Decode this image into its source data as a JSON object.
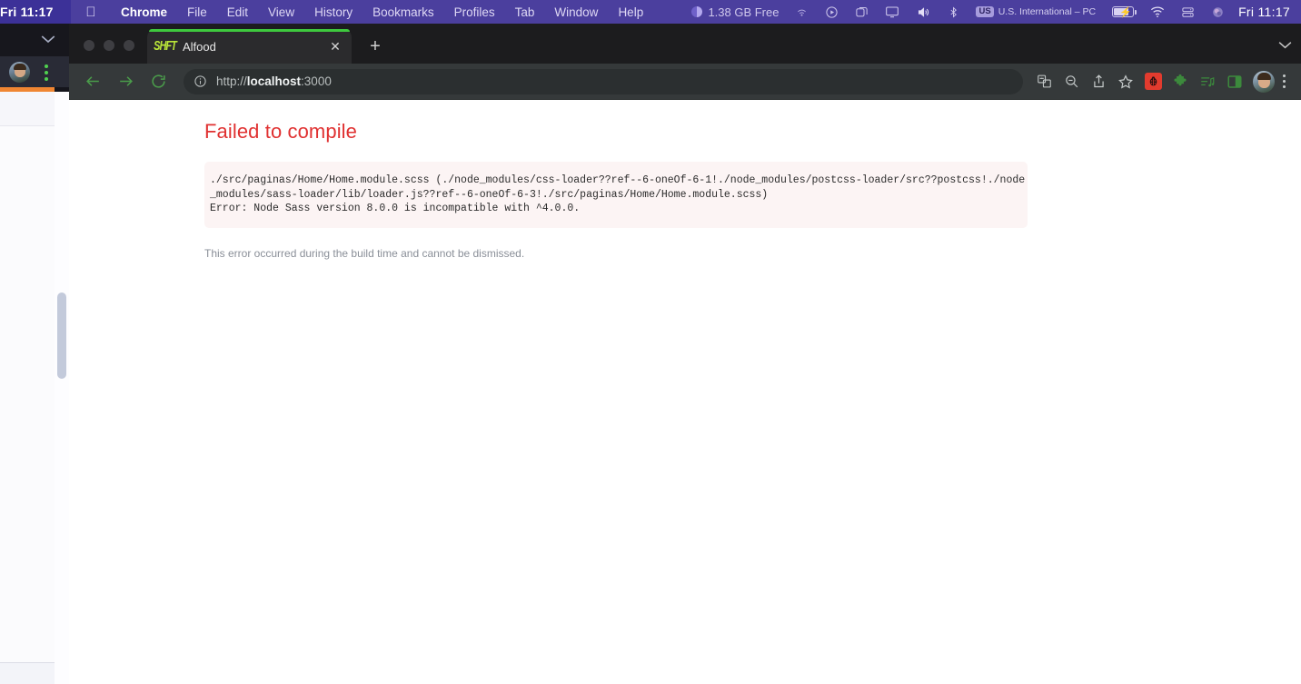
{
  "menubar": {
    "clock_left": "Fri  11:17",
    "apple_icon": "apple-logo",
    "items": [
      {
        "label": "Chrome",
        "bold": true
      },
      {
        "label": "File"
      },
      {
        "label": "Edit"
      },
      {
        "label": "View"
      },
      {
        "label": "History"
      },
      {
        "label": "Bookmarks"
      },
      {
        "label": "Profiles"
      },
      {
        "label": "Tab"
      },
      {
        "label": "Window"
      },
      {
        "label": "Help"
      }
    ],
    "status": {
      "memory": "1.38 GB Free",
      "airplay_icon": "airplay-icon",
      "record_icon": "record-circle-icon",
      "screens_icon": "screens-icon",
      "display_icon": "display-icon",
      "volume_icon": "volume-icon",
      "bluetooth_icon": "bluetooth-icon",
      "keyboard_badge": "US",
      "keyboard_label": "U.S. International – PC",
      "battery_icon": "battery-charging-icon",
      "wifi_icon": "wifi-icon",
      "timemachine_icon": "time-machine-icon",
      "siri_icon": "siri-icon",
      "clock": "Fri  11:17"
    }
  },
  "background_window": {
    "chevron_icon": "chevron-down-icon",
    "avatar": "profile-avatar",
    "menu_icon": "vertical-dots-icon"
  },
  "browser": {
    "traffic_lights": [
      "close",
      "minimize",
      "zoom"
    ],
    "tab": {
      "title": "Alfood",
      "favicon_text": "SHFT",
      "favicon_name": "shft-favicon",
      "close_glyph": "✕"
    },
    "new_tab_glyph": "+",
    "tabstrip_chevron": "chevron-down-icon",
    "toolbar": {
      "back_icon": "back-arrow-icon",
      "forward_icon": "forward-arrow-icon",
      "reload_icon": "reload-icon",
      "site_info_icon": "info-circle-icon",
      "url_scheme": "http://",
      "url_host": "localhost",
      "url_port": ":3000",
      "url_full": "http://localhost:3000",
      "translate_icon": "translate-icon",
      "zoom_out_icon": "zoom-out-icon",
      "share_icon": "share-icon",
      "bookmark_icon": "star-icon",
      "extension_red_icon": "ladybug-extension-icon",
      "extension_puzzle_icon": "puzzle-piece-icon",
      "media_list_icon": "media-playlist-icon",
      "side_panel_icon": "side-panel-icon",
      "profile_avatar": "profile-avatar",
      "menu_icon": "three-dot-menu-icon"
    }
  },
  "page": {
    "title": "Failed to compile",
    "error_line_1": "./src/paginas/Home/Home.module.scss (./node_modules/css-loader??ref--6-oneOf-6-1!./node_modules/postcss-loader/src??postcss!./node_modules/sass-loader/lib/loader.js??ref--6-oneOf-6-3!./src/paginas/Home/Home.module.scss)",
    "error_line_2": "Error: Node Sass version 8.0.0 is incompatible with ^4.0.0.",
    "note": "This error occurred during the build time and cannot be dismissed."
  },
  "colors": {
    "menubar_bg": "#4b3f9e",
    "error_title": "#e03131",
    "error_box_bg": "#fcf4f4",
    "tab_accent_green": "#3ec93e",
    "toolbar_bg": "#35393a"
  }
}
